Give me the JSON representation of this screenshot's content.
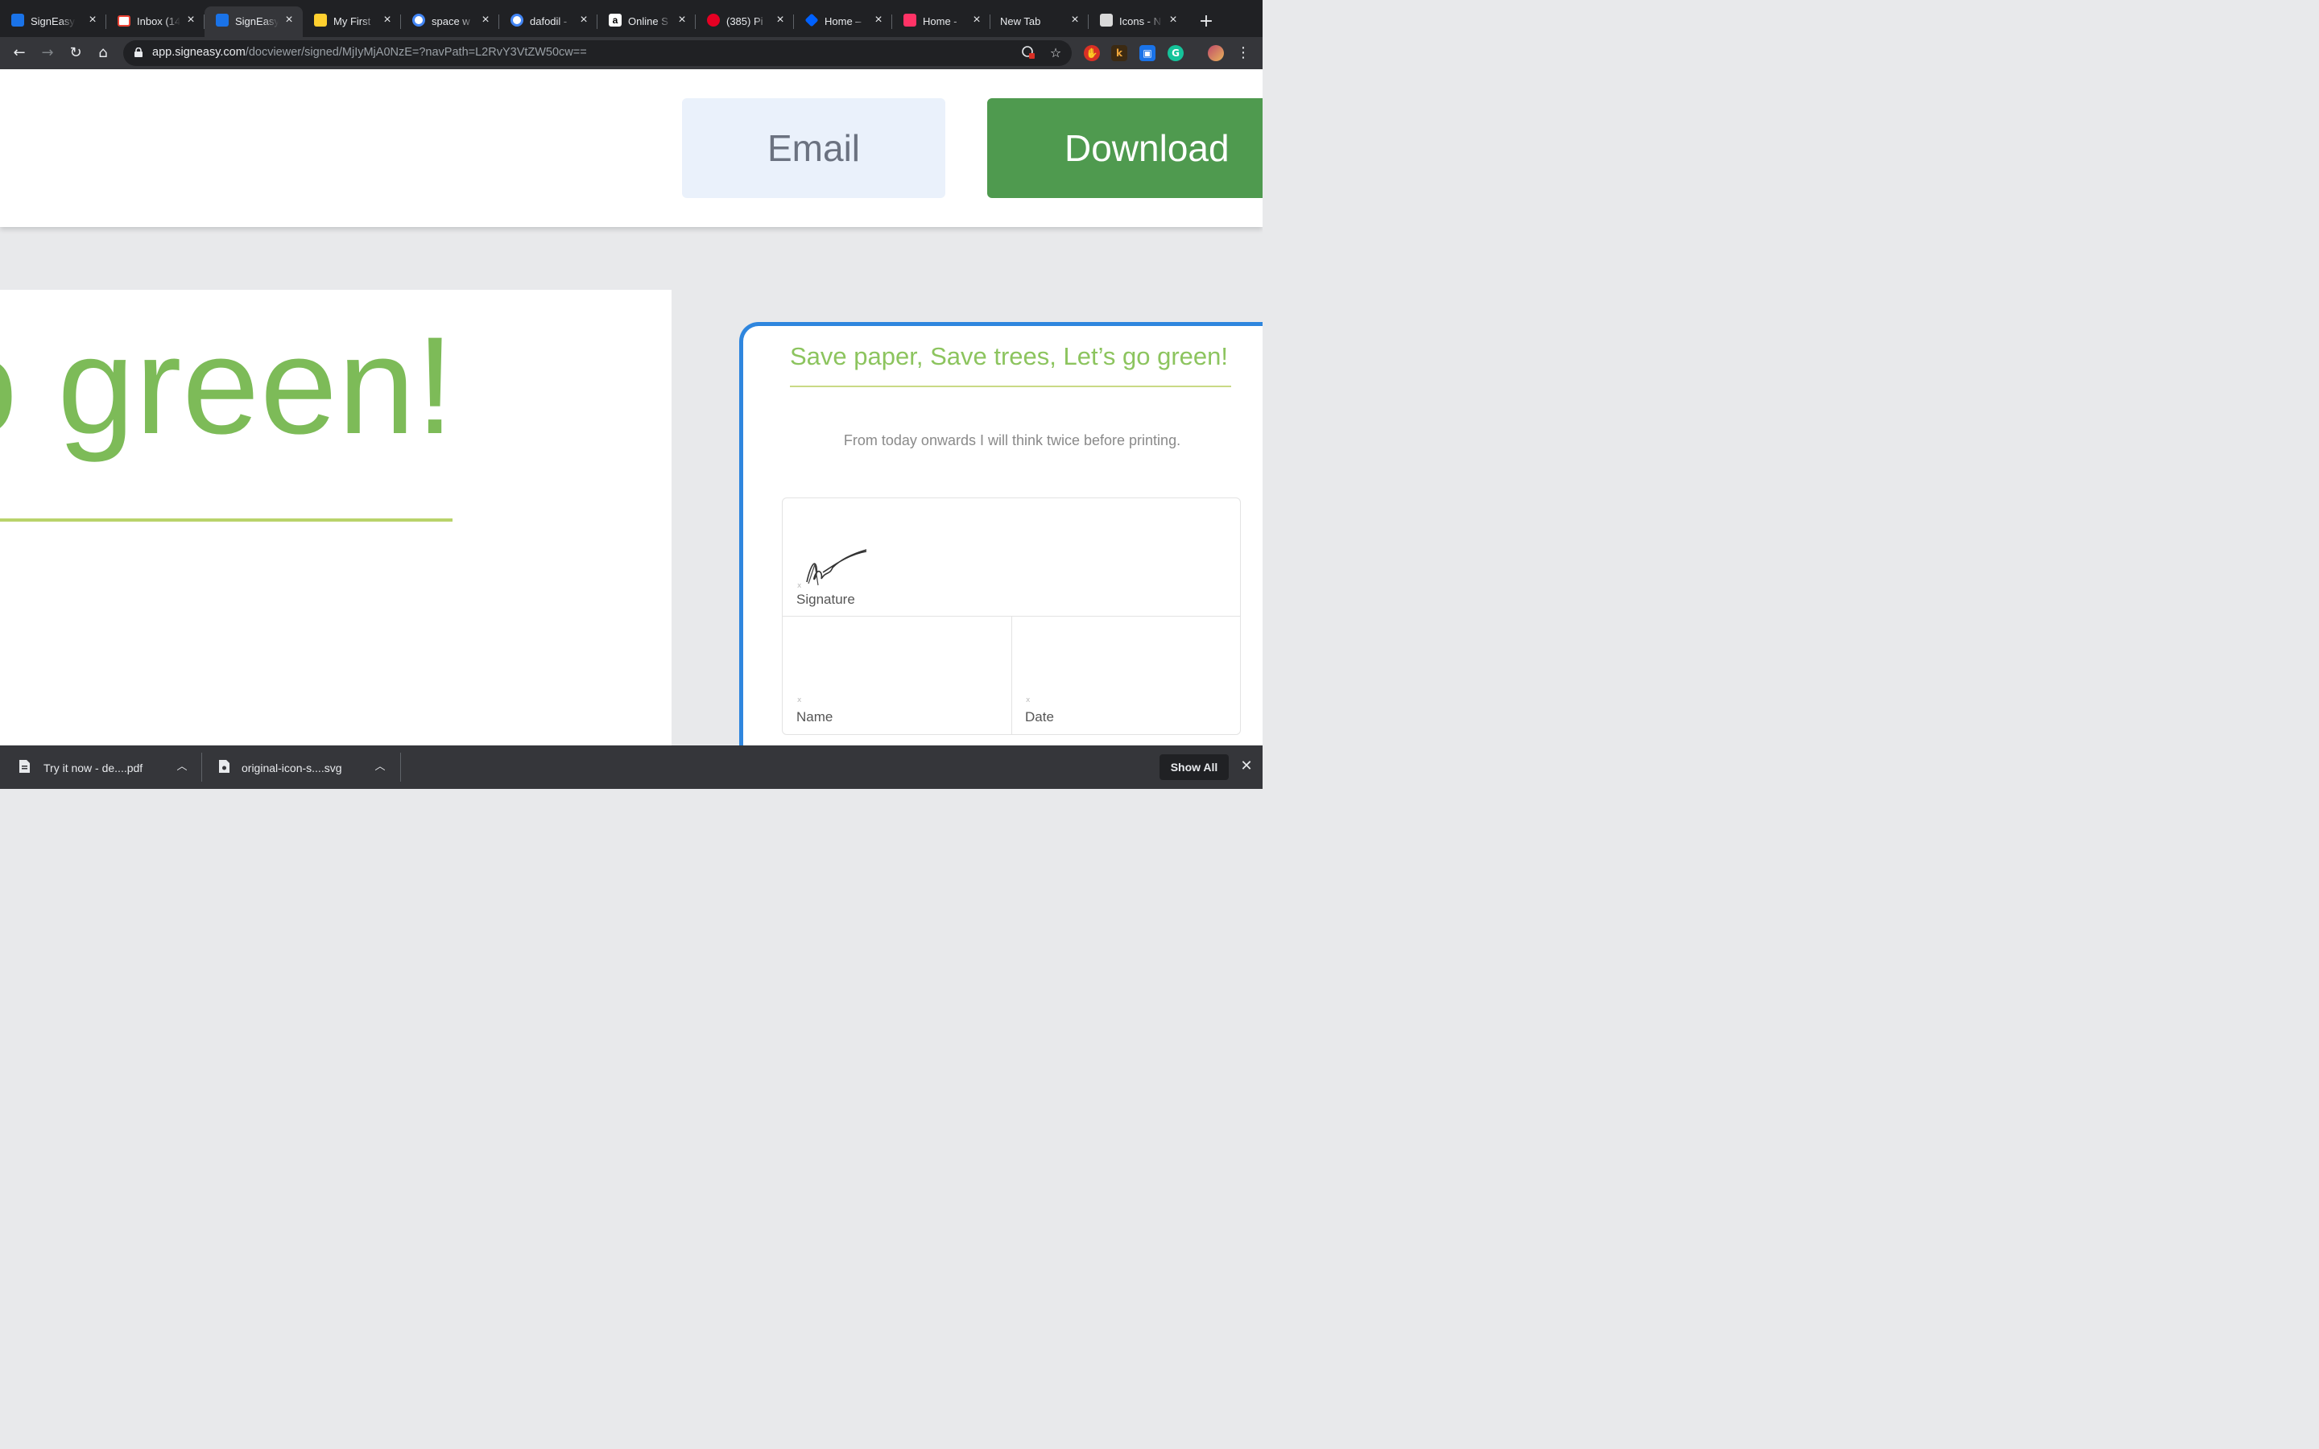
{
  "browser": {
    "tabs": [
      {
        "title": "SignEasy",
        "icon": "signeasy-icon",
        "color": "#1a73e8"
      },
      {
        "title": "Inbox (14",
        "icon": "gmail-icon",
        "color": "#ea4335"
      },
      {
        "title": "SignEasy",
        "icon": "signeasy-icon",
        "color": "#1a73e8",
        "active": true
      },
      {
        "title": "My First",
        "icon": "miro-icon",
        "color": "#ffd02f"
      },
      {
        "title": "space w",
        "icon": "google-icon",
        "color": "#4285f4"
      },
      {
        "title": "dafodil -",
        "icon": "google-icon",
        "color": "#4285f4"
      },
      {
        "title": "Online S",
        "icon": "amazon-icon",
        "color": "#ffffff"
      },
      {
        "title": "(385) Pi",
        "icon": "pinterest-icon",
        "color": "#e60023"
      },
      {
        "title": "Home –",
        "icon": "dropbox-icon",
        "color": "#0061fe"
      },
      {
        "title": "Home -",
        "icon": "invision-icon",
        "color": "#ff3366"
      },
      {
        "title": "New Tab",
        "icon": "",
        "color": ""
      },
      {
        "title": "Icons - N",
        "icon": "page-icon",
        "color": "#cccccc"
      }
    ],
    "url_host": "app.signeasy.com",
    "url_path": "/docviewer/signed/MjIyMjA0NzE=?navPath=L2RvY3VtZW50cw=="
  },
  "actions": {
    "email_label": "Email",
    "download_label": "Download"
  },
  "document": {
    "heading_fragment": "o green!",
    "preview": {
      "title": "Save paper, Save trees, Let’s go green!",
      "subtitle": "From today onwards I will think twice before printing.",
      "signature_label": "Signature",
      "name_label": "Name",
      "date_label": "Date",
      "field_marker": "x"
    }
  },
  "downloads": {
    "items": [
      {
        "name": "Try it now - de....pdf"
      },
      {
        "name": "original-icon-s....svg"
      }
    ],
    "show_all_label": "Show All"
  },
  "colors": {
    "brand_green": "#4f9a4f",
    "heading_green": "#7dbb58",
    "accent_blue": "#2f86de"
  }
}
